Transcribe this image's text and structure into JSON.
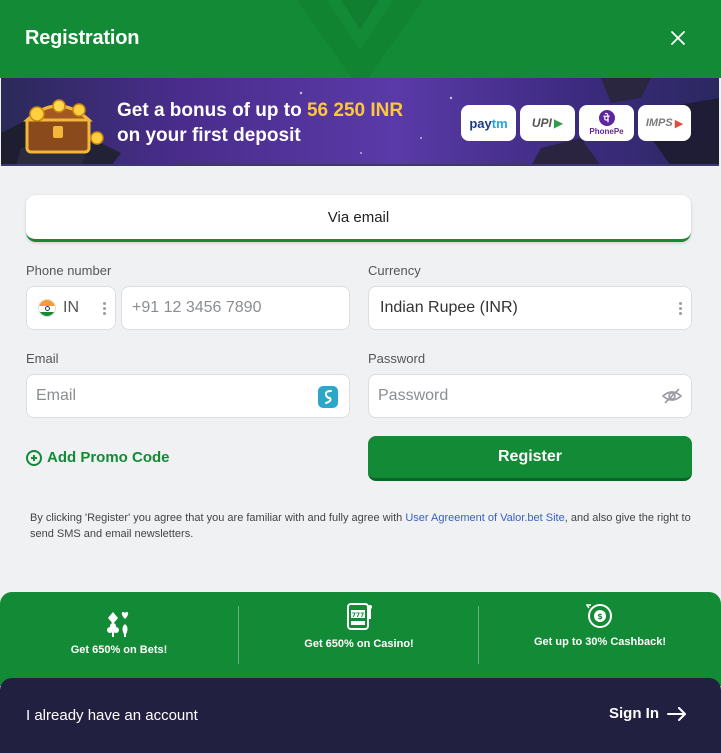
{
  "header": {
    "title": "Registration"
  },
  "banner": {
    "line1_prefix": "Get a bonus of up to ",
    "amount": "56 250 INR",
    "line2": "on your first deposit",
    "payments": [
      {
        "name": "paytm",
        "label_a": "pay",
        "label_b": "tm"
      },
      {
        "name": "upi",
        "label": "UPI"
      },
      {
        "name": "phonepe",
        "label": "PhonePe",
        "glyph": "पे"
      },
      {
        "name": "imps",
        "label": "IMPS"
      }
    ]
  },
  "tabs": [
    {
      "label": "Via email",
      "active": true
    }
  ],
  "form": {
    "phone": {
      "label": "Phone number",
      "country_code": "IN",
      "placeholder": "+91 12 3456 7890"
    },
    "currency": {
      "label": "Currency",
      "value": "Indian Rupee (INR)"
    },
    "email": {
      "label": "Email",
      "placeholder": "Email"
    },
    "password": {
      "label": "Password",
      "placeholder": "Password"
    },
    "promo_label": "Add Promo Code",
    "register_label": "Register"
  },
  "terms": {
    "before": "By clicking 'Register' you agree that you are familiar with and fully agree with ",
    "link": "User Agreement of Valor.bet Site",
    "after": ", and also give the right to send SMS and email newsletters."
  },
  "features": [
    {
      "icon": "cards-icon",
      "text": "Get 650% on Bets!"
    },
    {
      "icon": "slot-machine-icon",
      "text": "Get 650% on Casino!"
    },
    {
      "icon": "cashback-icon",
      "text": "Get up to 30% Cashback!"
    }
  ],
  "footer": {
    "have_account": "I already have an account",
    "signin_label": "Sign In"
  },
  "colors": {
    "brand_green": "#138a35",
    "footer_navy": "#212040",
    "link_blue": "#3a5fbf",
    "bonus_yellow": "#ffc83a"
  }
}
